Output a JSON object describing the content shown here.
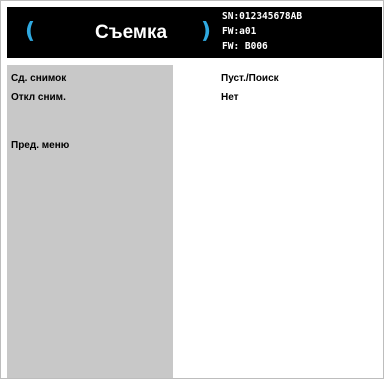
{
  "header": {
    "title": "Съемка",
    "serial": "SN:012345678AB",
    "fw_line1": "FW:a01",
    "fw_line2": "FW: B006",
    "accent_color": "#2fa9e0"
  },
  "menu": {
    "items": [
      {
        "label": "Сд. снимок",
        "value": "Пуст./Поиск"
      },
      {
        "label": "Откл сним.",
        "value": "Нет"
      },
      {
        "label": "Пред. меню",
        "value": ""
      }
    ]
  }
}
